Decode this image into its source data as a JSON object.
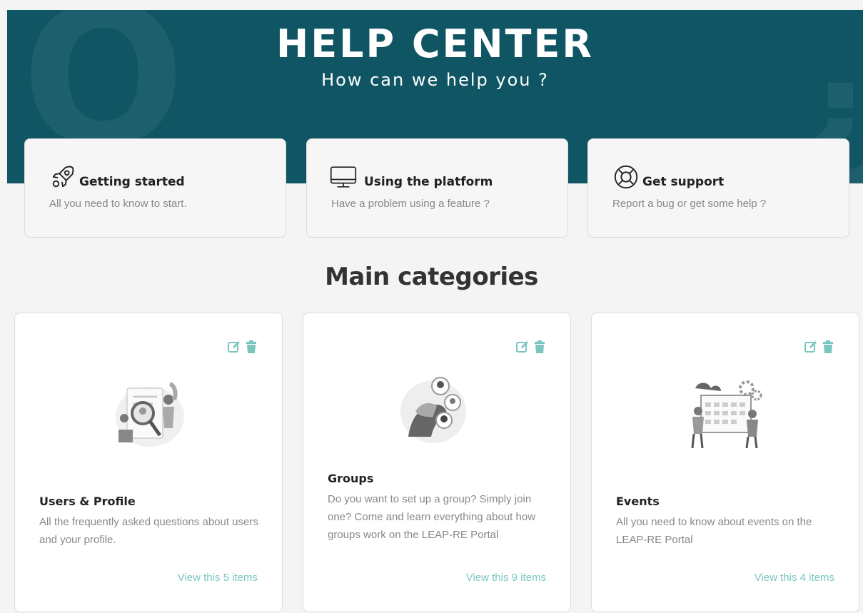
{
  "hero": {
    "title": "HELP CENTER",
    "subtitle": "How can we help you ?"
  },
  "quick_links": [
    {
      "icon": "rocket-icon",
      "title": "Getting started",
      "description": "All you need to know to start."
    },
    {
      "icon": "monitor-icon",
      "title": "Using the platform",
      "description": "Have a problem using a feature ?"
    },
    {
      "icon": "lifebuoy-icon",
      "title": "Get support",
      "description": "Report a bug or get some help ?"
    }
  ],
  "main_categories": {
    "title": "Main categories",
    "items": [
      {
        "title": "Users & Profile",
        "description": "All the frequently asked questions about users and your profile.",
        "link": "View this 5 items"
      },
      {
        "title": "Groups",
        "description": "Do you want to set up a group? Simply join one? Come and learn everything about how groups work on the LEAP-RE Portal",
        "link": "View this 9 items"
      },
      {
        "title": "Events",
        "description": "All you need to know about events on the LEAP-RE Portal",
        "link": "View this 4 items"
      }
    ]
  },
  "colors": {
    "hero_bg": "#0f5563",
    "accent": "#7cc6c0"
  }
}
